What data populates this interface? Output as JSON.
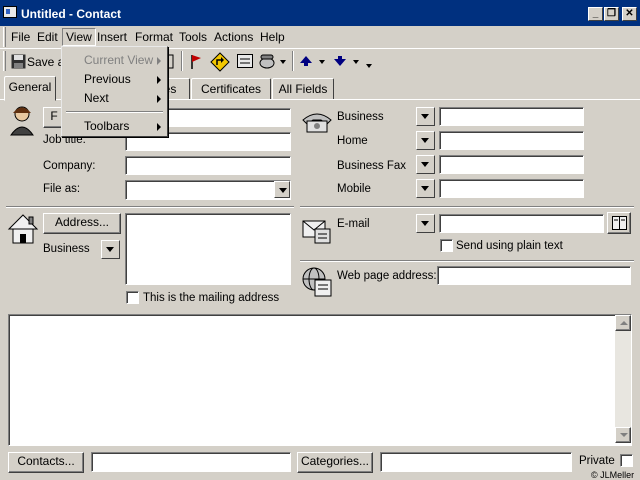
{
  "window": {
    "title": "Untitled - Contact"
  },
  "menubar": {
    "items": [
      "File",
      "Edit",
      "View",
      "Insert",
      "Format",
      "Tools",
      "Actions",
      "Help"
    ]
  },
  "view_menu": {
    "items": [
      "Current View",
      "Previous",
      "Next",
      "Toolbars"
    ]
  },
  "toolbar": {
    "save_label": "Save a"
  },
  "tabs": [
    "General",
    "es",
    "Certificates",
    "All Fields"
  ],
  "form": {
    "full_name_button": "F",
    "job_title_label": "Job title:",
    "company_label": "Company:",
    "file_as_label": "File as:",
    "address_button": "Address...",
    "address_type": "Business",
    "mailing_checkbox_label": "This is the mailing address",
    "phones": [
      "Business",
      "Home",
      "Business Fax",
      "Mobile"
    ],
    "email_label": "E-mail",
    "plain_text_label": "Send using plain text",
    "web_label": "Web page address:"
  },
  "footer": {
    "contacts_button": "Contacts...",
    "categories_button": "Categories...",
    "private_label": "Private",
    "copyright": "© JLMeller"
  },
  "colors": {
    "titlebar": "#00307f",
    "face": "#d4d0c8",
    "field": "#ffffff"
  }
}
